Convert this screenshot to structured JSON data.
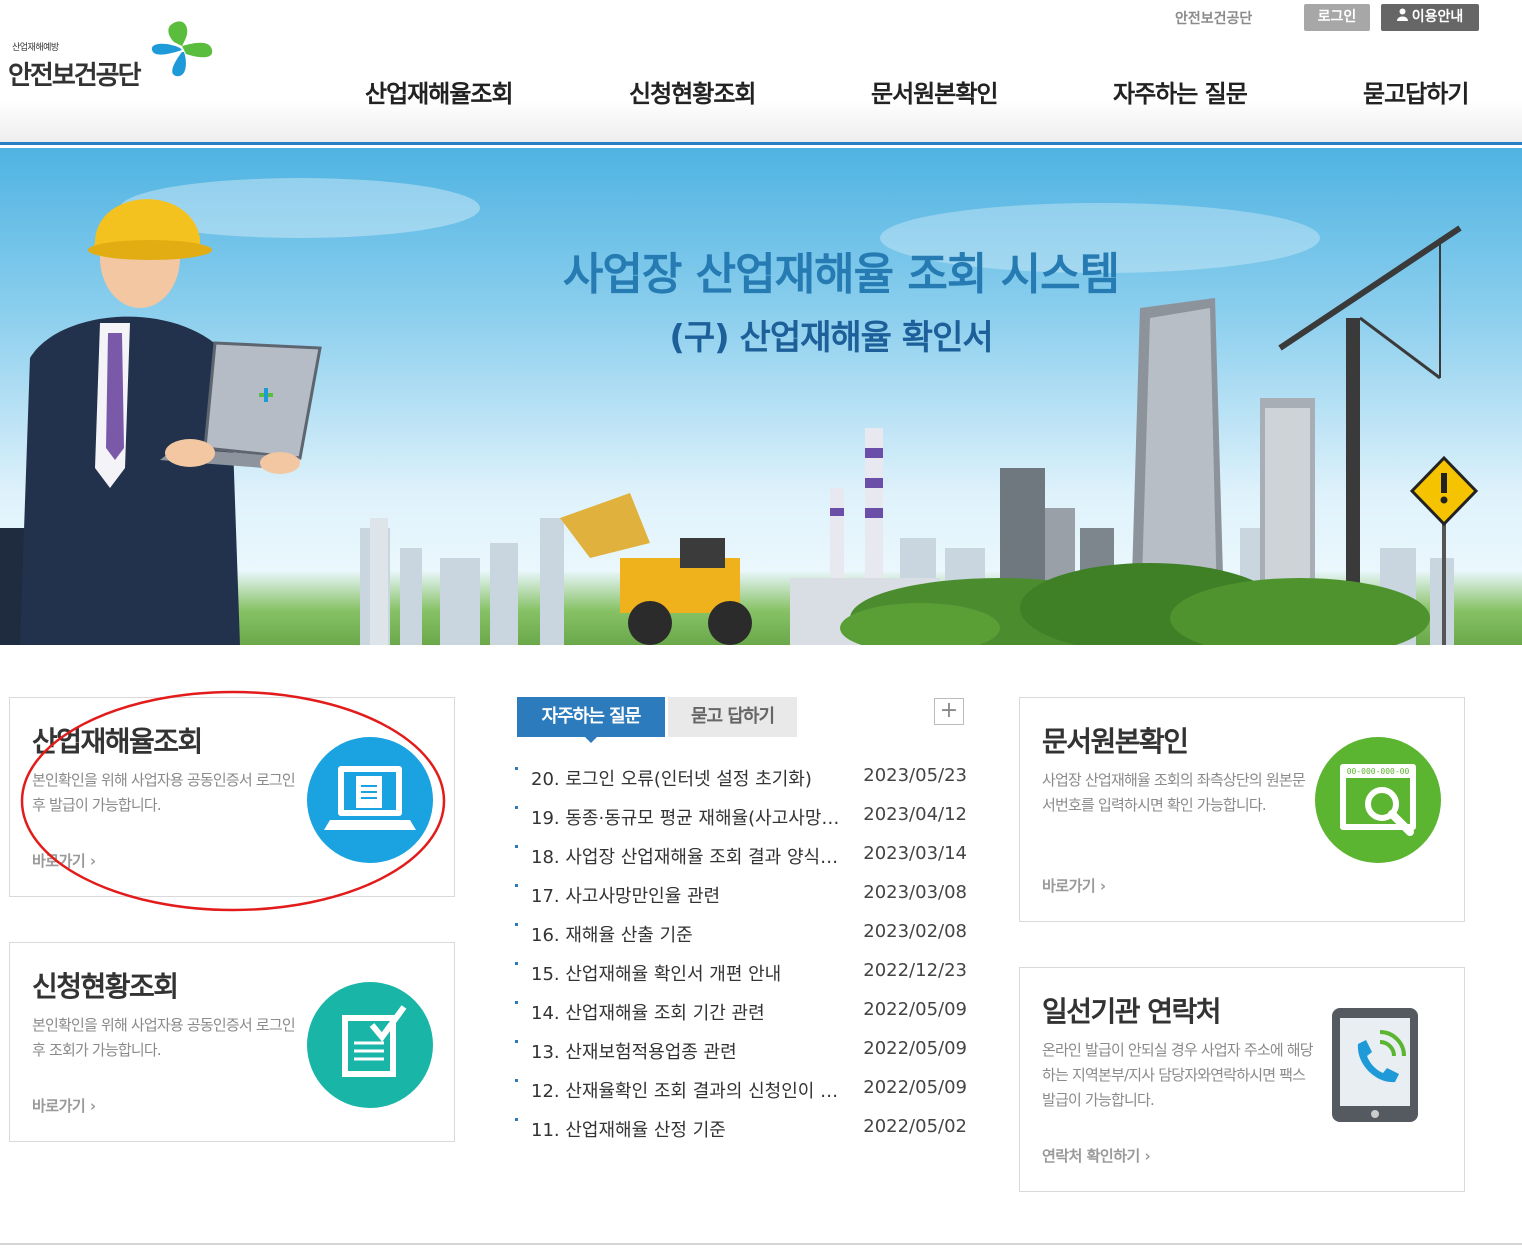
{
  "header": {
    "logo_sub": "산업재해예방",
    "logo_main": "안전보건공단",
    "util_org": "안전보건공단",
    "login": "로그인",
    "guide": "이용안내",
    "nav": [
      "산업재해율조회",
      "신청현황조회",
      "문서원본확인",
      "자주하는 질문",
      "묻고답하기"
    ]
  },
  "hero": {
    "title": "사업장 산업재해율 조회 시스템",
    "subtitle": "(구) 산업재해율 확인서"
  },
  "boxes": {
    "inquiry": {
      "title": "산업재해율조회",
      "desc": "본인확인을 위해 사업자용 공동인증서 로그인 후 발급이 가능합니다.",
      "link": "바로가기 ›",
      "icon": "computer-document-icon",
      "color": "#1aa3e0"
    },
    "status": {
      "title": "신청현황조회",
      "desc": "본인확인을 위해 사업자용 공동인증서 로그인 후 조회가 가능합니다.",
      "link": "바로가기 ›",
      "icon": "checklist-icon",
      "color": "#19b6a8"
    },
    "doc": {
      "title": "문서원본확인",
      "desc": "사업장 산업재해율 조회의 좌측상단의 원본문서번호를 입력하시면 확인 가능합니다.",
      "link": "바로가기 ›",
      "icon": "magnifier-document-icon",
      "code_text": "00-000-000-00",
      "color": "#5cb531"
    },
    "contact": {
      "title": "일선기관 연락처",
      "desc": "온라인 발급이 안되실 경우 사업자 주소에 해당하는 지역본부/지사 담당자와연락하시면 팩스 발급이 가능합니다.",
      "link": "연락처 확인하기 ›",
      "icon": "phone-icon"
    }
  },
  "board": {
    "tab_faq": "자주하는 질문",
    "tab_qna": "묻고 답하기",
    "more": "+",
    "items": [
      {
        "title": "20. 로그인 오류(인터넷 설정 초기화)",
        "date": "2023/05/23"
      },
      {
        "title": "19. 동종·동규모 평균 재해율(사고사망…",
        "date": "2023/04/12"
      },
      {
        "title": "18. 사업장 산업재해율 조회 결과 양식…",
        "date": "2023/03/14"
      },
      {
        "title": "17. 사고사망만인율 관련",
        "date": "2023/03/08"
      },
      {
        "title": "16. 재해율 산출 기준",
        "date": "2023/02/08"
      },
      {
        "title": "15. 산업재해율 확인서 개편 안내",
        "date": "2022/12/23"
      },
      {
        "title": "14. 산업재해율 조회 기간 관련",
        "date": "2022/05/09"
      },
      {
        "title": "13. 산재보험적용업종 관련",
        "date": "2022/05/09"
      },
      {
        "title": "12. 산재율확인 조회 결과의 신청인이 …",
        "date": "2022/05/09"
      },
      {
        "title": "11. 산업재해율 산정 기준",
        "date": "2022/05/02"
      }
    ]
  },
  "colors": {
    "accent_blue": "#2c7bbd",
    "annotation_red": "#e21b1b"
  }
}
